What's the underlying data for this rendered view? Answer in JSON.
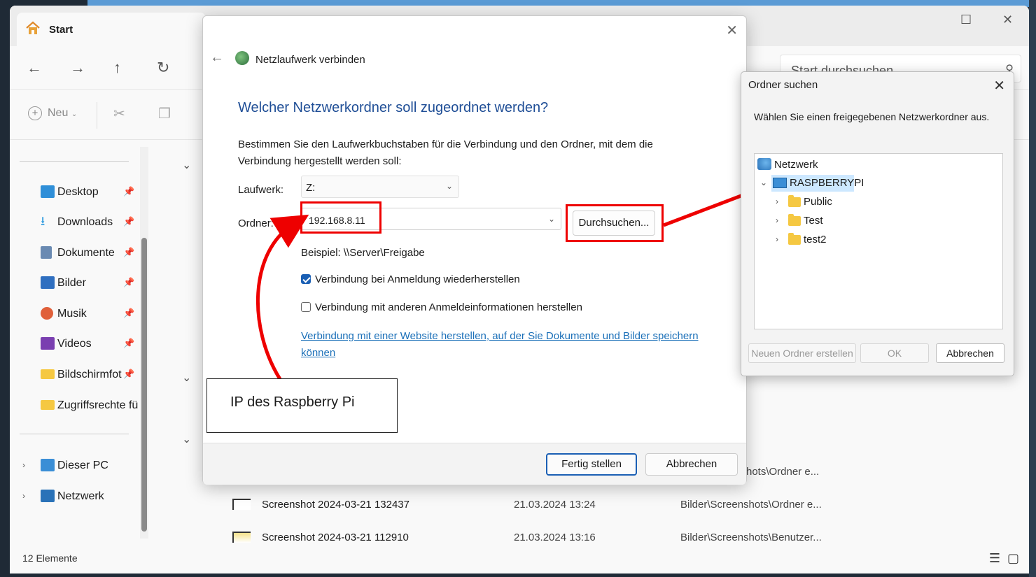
{
  "explorer": {
    "tab_title": "Start",
    "search_placeholder": "Start durchsuchen",
    "new_label": "Neu",
    "status": "12 Elemente",
    "sidebar": [
      {
        "label": "Desktop",
        "color": "#2f8fd8"
      },
      {
        "label": "Downloads",
        "color": "#3aa0e0"
      },
      {
        "label": "Dokumente",
        "color": "#6a8ab2"
      },
      {
        "label": "Bilder",
        "color": "#2f6fc0"
      },
      {
        "label": "Musik",
        "color": "#e0603a"
      },
      {
        "label": "Videos",
        "color": "#7a3fb0"
      },
      {
        "label": "Bildschirmfot",
        "color": "#f5c842"
      },
      {
        "label": "Zugriffsrechte fü",
        "color": "#f5c842"
      }
    ],
    "sidebar_bottom": [
      {
        "label": "Dieser PC"
      },
      {
        "label": "Netzwerk"
      }
    ],
    "files": [
      {
        "name": "Screenshot 2024-03-21 132437",
        "date": "21.03.2024 13:24",
        "path": "Bilder\\Screenshots\\Ordner e..."
      },
      {
        "name": "Screenshot 2024-03-21 112910",
        "date": "21.03.2024 13:16",
        "path": "Bilder\\Screenshots\\Benutzer..."
      }
    ],
    "partial_path": "hots\\Ordner e..."
  },
  "map_dialog": {
    "title": "Netzlaufwerk verbinden",
    "heading": "Welcher Netzwerkordner soll zugeordnet werden?",
    "description": "Bestimmen Sie den Laufwerkbuchstaben für die Verbindung und den Ordner, mit dem die Verbindung hergestellt werden soll:",
    "drive_label": "Laufwerk:",
    "drive_value": "Z:",
    "folder_label": "Ordner:",
    "folder_value": "192.168.8.11",
    "browse_label": "Durchsuchen...",
    "example": "Beispiel: \\\\Server\\Freigabe",
    "reconnect_label": "Verbindung bei Anmeldung wiederherstellen",
    "reconnect_checked": true,
    "other_creds_label": "Verbindung mit anderen Anmeldeinformationen herstellen",
    "other_creds_checked": false,
    "link": "Verbindung mit einer Website herstellen, auf der Sie Dokumente und Bilder speichern können",
    "finish_label": "Fertig stellen",
    "cancel_label": "Abbrechen"
  },
  "annotation": {
    "callout_text": "IP des Raspberry Pi",
    "color": "#e00000"
  },
  "browse_dialog": {
    "title": "Ordner suchen",
    "prompt": "Wählen Sie einen freigegebenen Netzwerkordner aus.",
    "root": "Netzwerk",
    "server": "RASPBERRYPI",
    "folders": [
      "Public",
      "Test",
      "test2"
    ],
    "new_folder_label": "Neuen Ordner erstellen",
    "ok_label": "OK",
    "cancel_label": "Abbrechen"
  }
}
